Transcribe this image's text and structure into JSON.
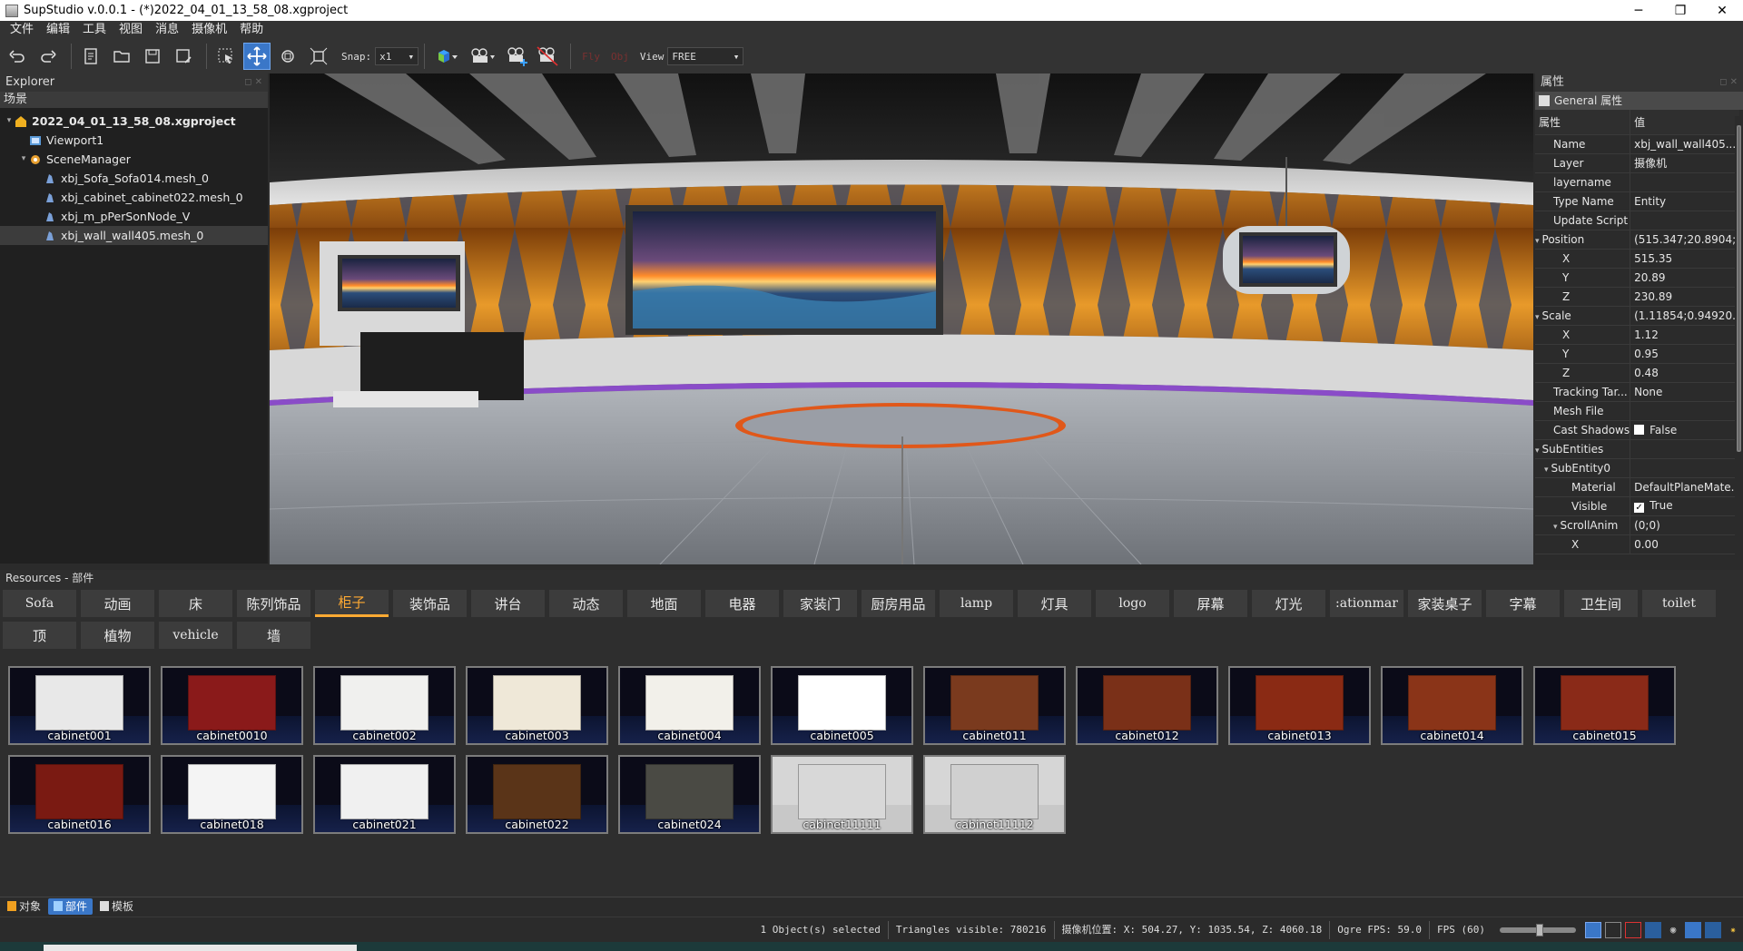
{
  "window": {
    "title": "SupStudio v.0.0.1 - (*)2022_04_01_13_58_08.xgproject",
    "minimize": "─",
    "maximize": "❐",
    "close": "✕"
  },
  "menu": [
    "文件",
    "编辑",
    "工具",
    "视图",
    "消息",
    "摄像机",
    "帮助"
  ],
  "toolbar": {
    "snap_label": "Snap:",
    "snap_value": "x1",
    "fly_label": "Fly",
    "obj_label": "Obj",
    "view_label": "View",
    "view_value": "FREE"
  },
  "explorer": {
    "title": "Explorer",
    "scene_header": "场景",
    "tree": [
      {
        "label": "2022_04_01_13_58_08.xgproject",
        "level": 0,
        "icon": "project-icon"
      },
      {
        "label": "Viewport1",
        "level": 1,
        "icon": "viewport-icon"
      },
      {
        "label": "SceneManager",
        "level": 1,
        "icon": "scene-manager-icon"
      },
      {
        "label": "xbj_Sofa_Sofa014.mesh_0",
        "level": 2,
        "icon": "mesh-icon"
      },
      {
        "label": "xbj_cabinet_cabinet022.mesh_0",
        "level": 2,
        "icon": "mesh-icon"
      },
      {
        "label": "xbj_m_pPerSonNode_V",
        "level": 2,
        "icon": "mesh-icon"
      },
      {
        "label": "xbj_wall_wall405.mesh_0",
        "level": 2,
        "icon": "mesh-icon"
      }
    ]
  },
  "properties": {
    "title": "属性",
    "general_tab": "General 属性",
    "col_key": "属性",
    "col_value": "值",
    "rows": [
      {
        "k": "Name",
        "v": "xbj_wall_wall405....",
        "indent": 1
      },
      {
        "k": "Layer",
        "v": "摄像机",
        "indent": 1
      },
      {
        "k": "layername",
        "v": "",
        "indent": 1
      },
      {
        "k": "Type Name",
        "v": "Entity",
        "indent": 1
      },
      {
        "k": "Update Script",
        "v": "",
        "indent": 1
      },
      {
        "k": "Position",
        "v": "(515.347;20.8904;...",
        "indent": 0,
        "expand": true
      },
      {
        "k": "X",
        "v": "515.35",
        "indent": 2
      },
      {
        "k": "Y",
        "v": "20.89",
        "indent": 2
      },
      {
        "k": "Z",
        "v": "230.89",
        "indent": 2
      },
      {
        "k": "Scale",
        "v": "(1.11854;0.94920...",
        "indent": 0,
        "expand": true
      },
      {
        "k": "X",
        "v": "1.12",
        "indent": 2
      },
      {
        "k": "Y",
        "v": "0.95",
        "indent": 2
      },
      {
        "k": "Z",
        "v": "0.48",
        "indent": 2
      },
      {
        "k": "Tracking Tar...",
        "v": "None",
        "indent": 1
      },
      {
        "k": "Mesh File",
        "v": "",
        "indent": 1
      },
      {
        "k": "Cast Shadows",
        "v": "False",
        "indent": 1,
        "check": true
      },
      {
        "k": "SubEntities",
        "v": "",
        "indent": 0,
        "expand": true
      },
      {
        "k": "SubEntity0",
        "v": "",
        "indent": 1,
        "expand": true
      },
      {
        "k": "Material",
        "v": "DefaultPlaneMate...",
        "indent": 3
      },
      {
        "k": "Visible",
        "v": "True",
        "indent": 3,
        "check": true
      },
      {
        "k": "ScrollAnim",
        "v": "(0;0)",
        "indent": 2,
        "expand": true
      },
      {
        "k": "X",
        "v": "0.00",
        "indent": 3
      }
    ]
  },
  "resources": {
    "title": "Resources - 部件",
    "categories_row1": [
      "Sofa",
      "动画",
      "床",
      "陈列饰品",
      "柜子",
      "装饰品",
      "讲台",
      "动态",
      "地面",
      "电器",
      "家装门",
      "厨房用品",
      "lamp",
      "灯具",
      "logo",
      "屏幕",
      "灯光",
      ":ationmar",
      "家装桌子",
      "字幕",
      "卫生间",
      "toilet"
    ],
    "categories_row2": [
      "顶",
      "植物",
      "vehicle",
      "墙"
    ],
    "active_category": "柜子",
    "thumbs_row1": [
      "cabinet001",
      "cabinet0010",
      "cabinet002",
      "cabinet003",
      "cabinet004",
      "cabinet005",
      "cabinet011",
      "cabinet012",
      "cabinet013",
      "cabinet014",
      "cabinet015"
    ],
    "thumbs_row2": [
      "cabinet016",
      "cabinet018",
      "cabinet021",
      "cabinet022",
      "cabinet024",
      "cabinet11111",
      "cabinet11112"
    ]
  },
  "bottom_tabs": [
    "对象",
    "部件",
    "模板"
  ],
  "status": {
    "selected": "1 Object(s) selected",
    "triangles": "Triangles visible: 780216",
    "camera_pos": "摄像机位置: X: 504.27, Y: 1035.54, Z: 4060.18",
    "ogre_fps": "Ogre FPS: 59.0",
    "fps_label": "FPS (60)"
  }
}
